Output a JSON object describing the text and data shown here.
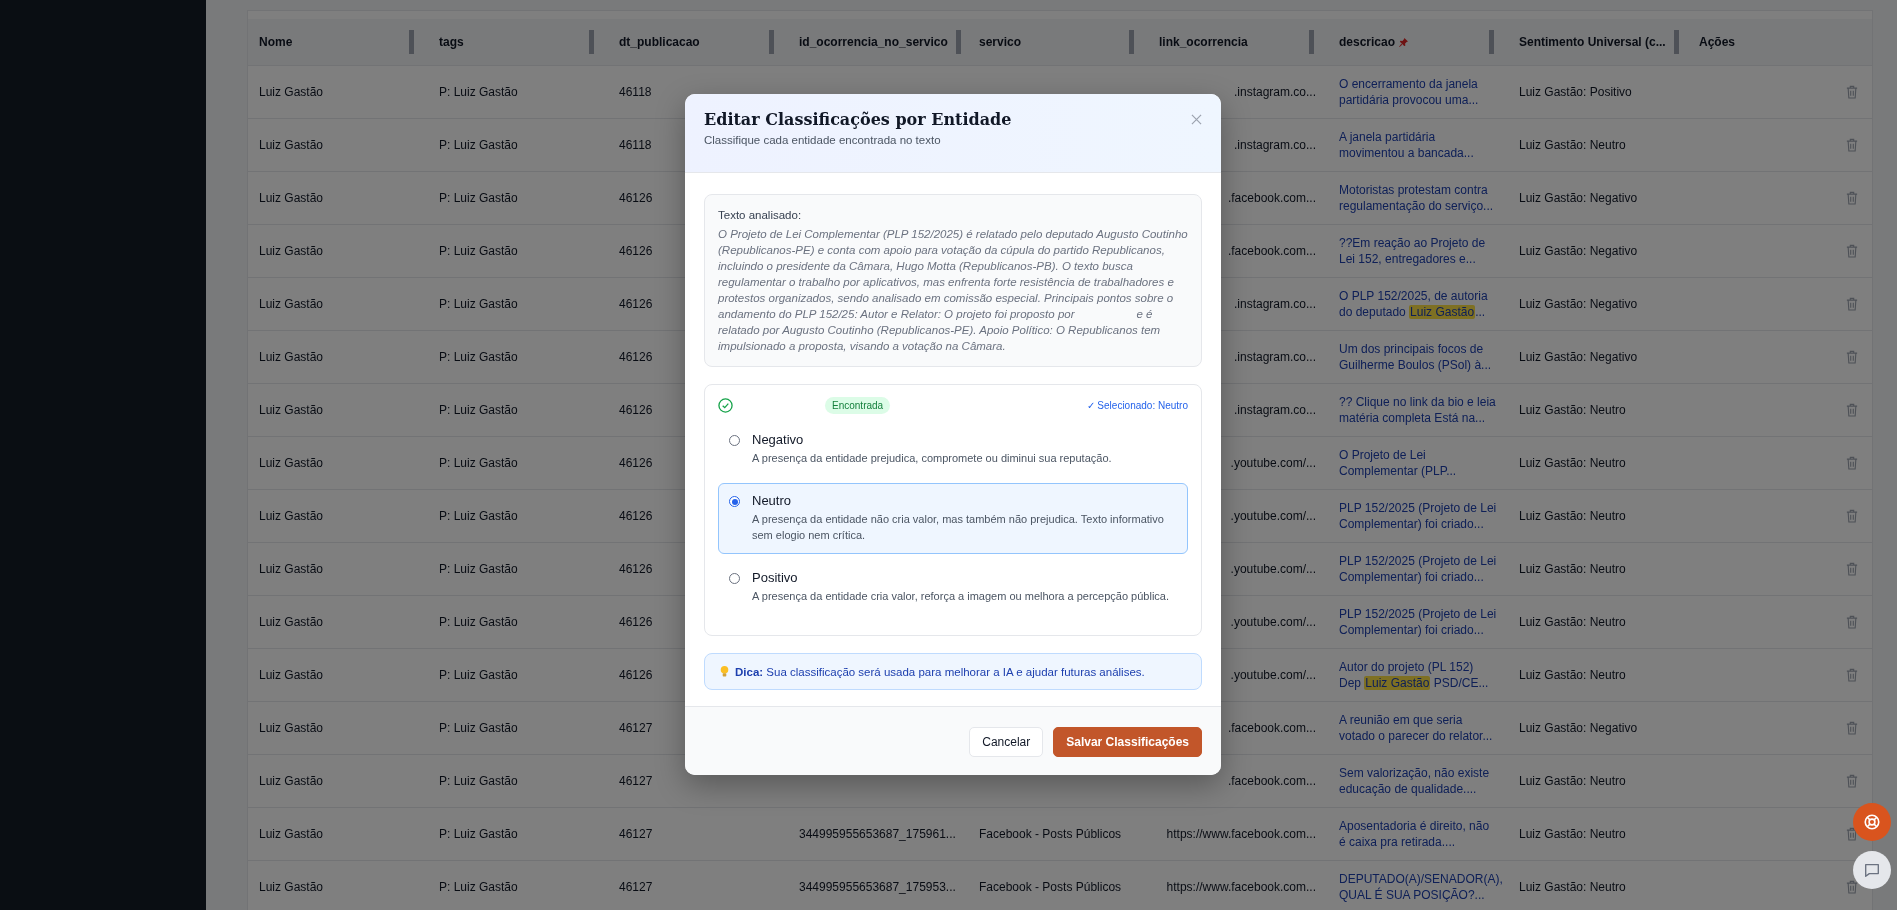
{
  "table": {
    "columns": [
      {
        "label": "Nome",
        "kind": "text",
        "resizable": true,
        "pinned": false
      },
      {
        "label": "tags",
        "kind": "text",
        "resizable": true,
        "pinned": false
      },
      {
        "label": "dt_publicacao",
        "kind": "text",
        "resizable": true,
        "pinned": false
      },
      {
        "label": "id_ocorrencia_no_servico",
        "kind": "text",
        "resizable": true,
        "pinned": false
      },
      {
        "label": "servico",
        "kind": "text",
        "resizable": true,
        "pinned": false
      },
      {
        "label": "link_ocorrencia",
        "kind": "text",
        "resizable": true,
        "pinned": false
      },
      {
        "label": "descricao",
        "kind": "text",
        "resizable": true,
        "pinned": true
      },
      {
        "label": "Sentimento Universal (c...",
        "kind": "text",
        "resizable": true,
        "pinned": false
      },
      {
        "label": "Ações",
        "kind": "actions",
        "resizable": false,
        "pinned": false
      }
    ],
    "rows": [
      {
        "nome": "Luiz Gastão",
        "tag": "P: Luiz Gastão",
        "dt": "46118",
        "link": ".instagram.co...",
        "descricao": [
          [
            {
              "text": "O encerramento da janela",
              "highlight": false
            }
          ],
          [
            {
              "text": "partidária provocou uma...",
              "highlight": false
            }
          ]
        ],
        "sentimento": "Luiz Gastão: Positivo"
      },
      {
        "nome": "Luiz Gastão",
        "tag": "P: Luiz Gastão",
        "dt": "46118",
        "link": ".instagram.co...",
        "descricao": [
          [
            {
              "text": "A janela partidária",
              "highlight": false
            }
          ],
          [
            {
              "text": "movimentou a bancada...",
              "highlight": false
            }
          ]
        ],
        "sentimento": "Luiz Gastão: Neutro"
      },
      {
        "nome": "Luiz Gastão",
        "tag": "P: Luiz Gastão",
        "dt": "46126",
        "link": ".facebook.com...",
        "descricao": [
          [
            {
              "text": "Motoristas protestam contra",
              "highlight": false
            }
          ],
          [
            {
              "text": "regulamentação do serviço...",
              "highlight": false
            }
          ]
        ],
        "sentimento": "Luiz Gastão: Negativo"
      },
      {
        "nome": "Luiz Gastão",
        "tag": "P: Luiz Gastão",
        "dt": "46126",
        "link": ".facebook.com...",
        "descricao": [
          [
            {
              "text": "??Em reação ao Projeto de",
              "highlight": false
            }
          ],
          [
            {
              "text": "Lei 152, entregadores e...",
              "highlight": false
            }
          ]
        ],
        "sentimento": "Luiz Gastão: Negativo"
      },
      {
        "nome": "Luiz Gastão",
        "tag": "P: Luiz Gastão",
        "dt": "46126",
        "link": ".instagram.co...",
        "descricao": [
          [
            {
              "text": "O PLP 152/2025, de autoria",
              "highlight": false
            }
          ],
          [
            {
              "text": "do deputado ",
              "highlight": false
            },
            {
              "text": "Luiz Gastão",
              "highlight": true
            },
            {
              "text": "...",
              "highlight": false
            }
          ]
        ],
        "sentimento": "Luiz Gastão: Negativo"
      },
      {
        "nome": "Luiz Gastão",
        "tag": "P: Luiz Gastão",
        "dt": "46126",
        "link": ".instagram.co...",
        "descricao": [
          [
            {
              "text": "Um dos principais focos de",
              "highlight": false
            }
          ],
          [
            {
              "text": "Guilherme Boulos (PSol) à...",
              "highlight": false
            }
          ]
        ],
        "sentimento": "Luiz Gastão: Negativo"
      },
      {
        "nome": "Luiz Gastão",
        "tag": "P: Luiz Gastão",
        "dt": "46126",
        "link": ".instagram.co...",
        "descricao": [
          [
            {
              "text": "?? Clique no link da bio e leia",
              "highlight": false
            }
          ],
          [
            {
              "text": "matéria completa Está na...",
              "highlight": false
            }
          ]
        ],
        "sentimento": "Luiz Gastão: Neutro"
      },
      {
        "nome": "Luiz Gastão",
        "tag": "P: Luiz Gastão",
        "dt": "46126",
        "link": ".youtube.com/...",
        "descricao": [
          [
            {
              "text": "O Projeto de Lei",
              "highlight": false
            }
          ],
          [
            {
              "text": "Complementar (PLP...",
              "highlight": false
            }
          ]
        ],
        "sentimento": "Luiz Gastão: Neutro"
      },
      {
        "nome": "Luiz Gastão",
        "tag": "P: Luiz Gastão",
        "dt": "46126",
        "link": ".youtube.com/...",
        "descricao": [
          [
            {
              "text": "PLP 152/2025 (Projeto de Lei",
              "highlight": false
            }
          ],
          [
            {
              "text": "Complementar) foi criado...",
              "highlight": false
            }
          ]
        ],
        "sentimento": "Luiz Gastão: Neutro"
      },
      {
        "nome": "Luiz Gastão",
        "tag": "P: Luiz Gastão",
        "dt": "46126",
        "link": ".youtube.com/...",
        "descricao": [
          [
            {
              "text": "PLP 152/2025 (Projeto de Lei",
              "highlight": false
            }
          ],
          [
            {
              "text": "Complementar) foi criado...",
              "highlight": false
            }
          ]
        ],
        "sentimento": "Luiz Gastão: Neutro"
      },
      {
        "nome": "Luiz Gastão",
        "tag": "P: Luiz Gastão",
        "dt": "46126",
        "link": ".youtube.com/...",
        "descricao": [
          [
            {
              "text": "PLP 152/2025 (Projeto de Lei",
              "highlight": false
            }
          ],
          [
            {
              "text": "Complementar) foi criado...",
              "highlight": false
            }
          ]
        ],
        "sentimento": "Luiz Gastão: Neutro"
      },
      {
        "nome": "Luiz Gastão",
        "tag": "P: Luiz Gastão",
        "dt": "46126",
        "link": ".youtube.com/...",
        "descricao": [
          [
            {
              "text": "Autor do projeto (PL 152)",
              "highlight": false
            }
          ],
          [
            {
              "text": "Dep ",
              "highlight": false
            },
            {
              "text": "Luiz Gastão",
              "highlight": true
            },
            {
              "text": " PSD/CE...",
              "highlight": false
            }
          ]
        ],
        "sentimento": "Luiz Gastão: Neutro"
      },
      {
        "nome": "Luiz Gastão",
        "tag": "P: Luiz Gastão",
        "dt": "46127",
        "link": ".facebook.com...",
        "descricao": [
          [
            {
              "text": "A reunião em que seria",
              "highlight": false
            }
          ],
          [
            {
              "text": "votado o parecer do relator...",
              "highlight": false
            }
          ]
        ],
        "sentimento": "Luiz Gastão: Negativo"
      },
      {
        "nome": "Luiz Gastão",
        "tag": "P: Luiz Gastão",
        "dt": "46127",
        "link": ".facebook.com...",
        "descricao": [
          [
            {
              "text": "Sem valorização, não existe",
              "highlight": false
            }
          ],
          [
            {
              "text": "educação de qualidade....",
              "highlight": false
            }
          ]
        ],
        "sentimento": "Luiz Gastão: Neutro"
      },
      {
        "nome": "Luiz Gastão",
        "tag": "P: Luiz Gastão",
        "dt": "46127",
        "id": "344995955653687_175961...",
        "servico": "Facebook - Posts Públicos",
        "link": "https://www.facebook.com...",
        "descricao": [
          [
            {
              "text": "Aposentadoria é direito, não",
              "highlight": false
            }
          ],
          [
            {
              "text": "é caixa pra retirada....",
              "highlight": false
            }
          ]
        ],
        "sentimento": "Luiz Gastão: Neutro"
      },
      {
        "nome": "Luiz Gastão",
        "tag": "P: Luiz Gastão",
        "dt": "46127",
        "id": "344995955653687_175953...",
        "servico": "Facebook - Posts Públicos",
        "link": "https://www.facebook.com...",
        "descricao": [
          [
            {
              "text": "DEPUTADO(A)/SENADOR(A),",
              "highlight": false
            }
          ],
          [
            {
              "text": "QUAL É SUA POSIÇÃO?...",
              "highlight": false
            }
          ]
        ],
        "sentimento": "Luiz Gastão: Neutro"
      }
    ]
  },
  "modal": {
    "title": "Editar Classificações por Entidade",
    "subtitle": "Classifique cada entidade encontrada no texto",
    "analyzed_label": "Texto analisado:",
    "analyzed_text": [
      "O Projeto de Lei Complementar (PLP 152/2025) é relatado pelo deputado Augusto Coutinho (Republicanos-PE) e conta com apoio para votação da cúpula do partido Republicanos, incluindo o presidente da Câmara, Hugo Motta (Republicanos-PB). O texto busca regulamentar o trabalho por aplicativos, mas enfrenta forte resistência de trabalhadores e protestos organizados, sendo analisado em comissão especial. Principais pontos sobre o andamento do PLP 152/25: Autor e Relator: O projeto foi proposto por",
      "e é relatado por Augusto Coutinho (Republicanos-PE). Apoio Político: O Republicanos tem impulsionado a proposta, visando a votação na Câmara."
    ],
    "entity": {
      "found": true,
      "badge": "Encontrada",
      "selected_note": "✓ Selecionado: Neutro",
      "options": [
        {
          "label": "Negativo",
          "description": "A presença da entidade prejudica, compromete ou diminui sua reputação.",
          "selected": false
        },
        {
          "label": "Neutro",
          "description": "A presença da entidade não cria valor, mas também não prejudica. Texto informativo sem elogio nem crítica.",
          "selected": true
        },
        {
          "label": "Positivo",
          "description": "A presença da entidade cria valor, reforça a imagem ou melhora a percepção pública.",
          "selected": false
        }
      ]
    },
    "tip": "**Dica:** Sua classificação será usada para melhorar a IA e ajudar futuras análises.",
    "buttons": [
      {
        "label": "Cancelar",
        "kind": "secondary"
      },
      {
        "label": "Salvar Classificações",
        "kind": "primary"
      }
    ]
  },
  "floating_buttons": [
    {
      "kind": "help"
    },
    {
      "kind": "chat"
    }
  ]
}
